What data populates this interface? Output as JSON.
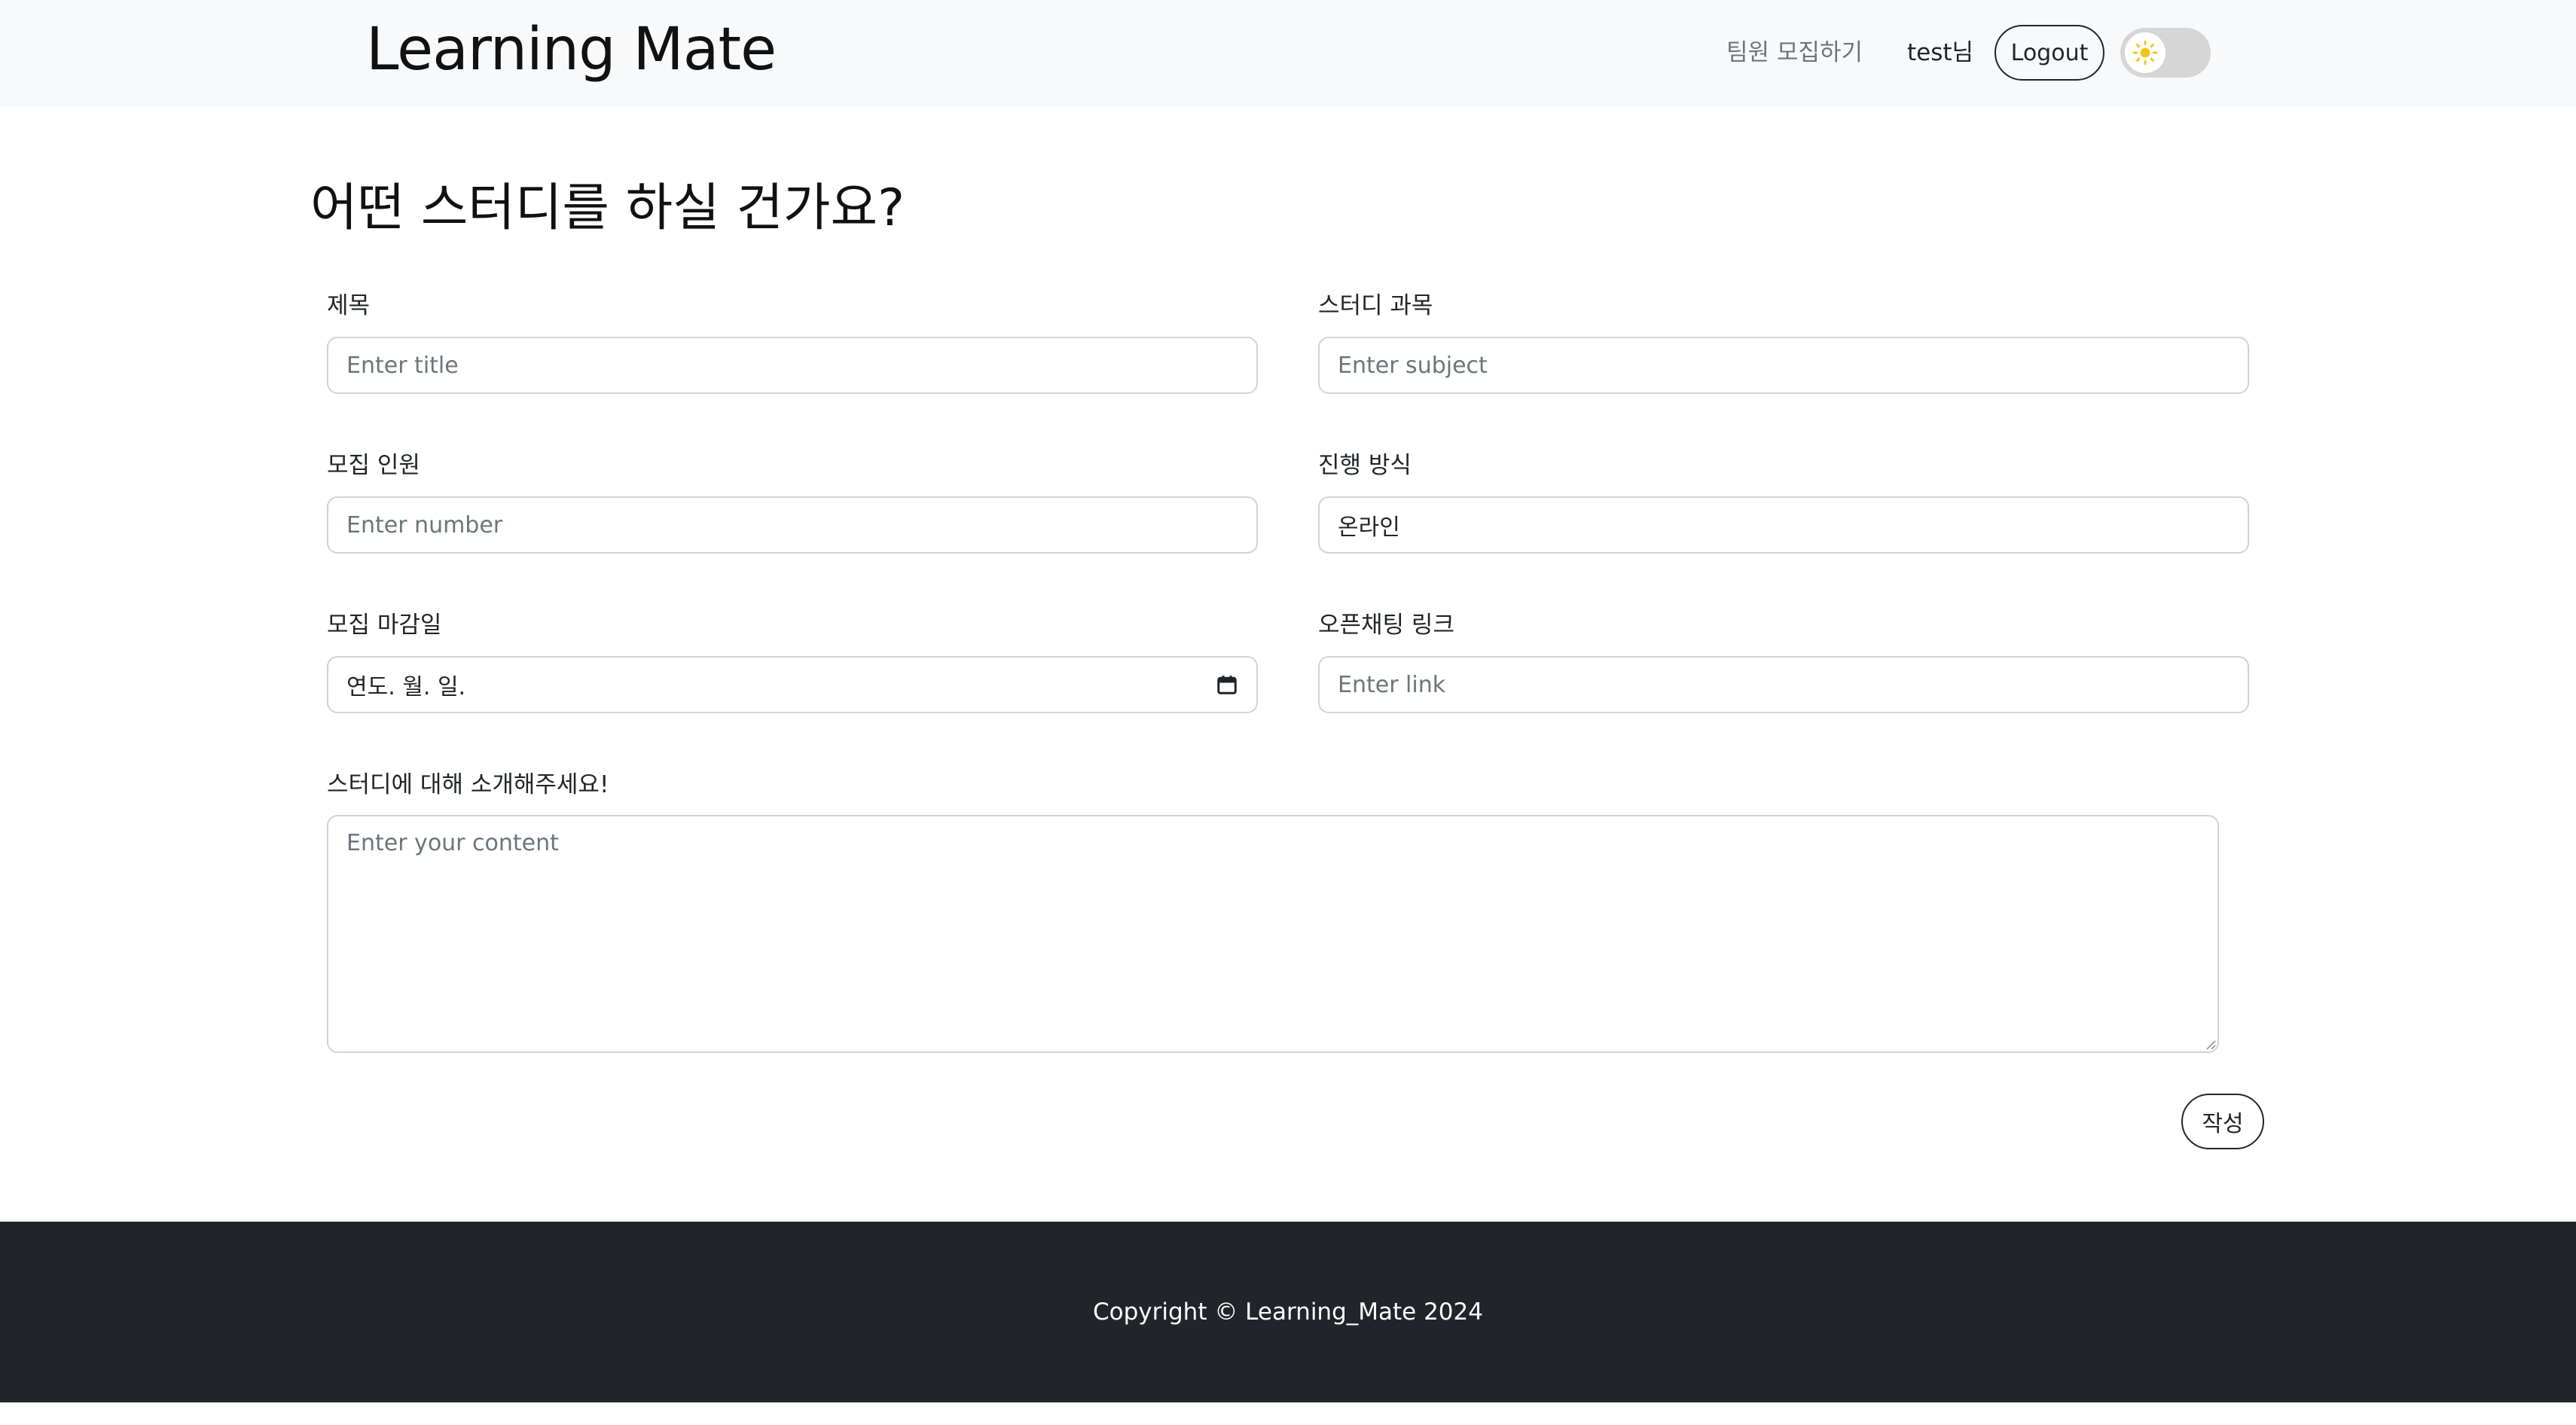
{
  "header": {
    "brand": "Learning Mate",
    "nav_recruit": "팀원 모집하기",
    "user_greeting": "test님",
    "logout_label": "Logout",
    "theme_toggle_icon": "sun-icon"
  },
  "main": {
    "title": "어떤 스터디를 하실 건가요?",
    "fields": {
      "title": {
        "label": "제목",
        "placeholder": "Enter title"
      },
      "subject": {
        "label": "스터디 과목",
        "placeholder": "Enter subject"
      },
      "members": {
        "label": "모집 인원",
        "placeholder": "Enter number"
      },
      "mode": {
        "label": "진행 방식",
        "value": "온라인"
      },
      "deadline": {
        "label": "모집 마감일",
        "value": "연도. 월. 일."
      },
      "link": {
        "label": "오픈채팅 링크",
        "placeholder": "Enter link"
      },
      "content": {
        "label": "스터디에 대해 소개해주세요!",
        "placeholder": "Enter your content"
      }
    },
    "submit_label": "작성"
  },
  "footer": {
    "copyright": "Copyright © Learning_Mate 2024"
  },
  "colors": {
    "navbar_bg": "#f8f9fa",
    "footer_bg": "#212529",
    "toggle_track": "#d6d6d6",
    "sun": "#f0c419"
  }
}
